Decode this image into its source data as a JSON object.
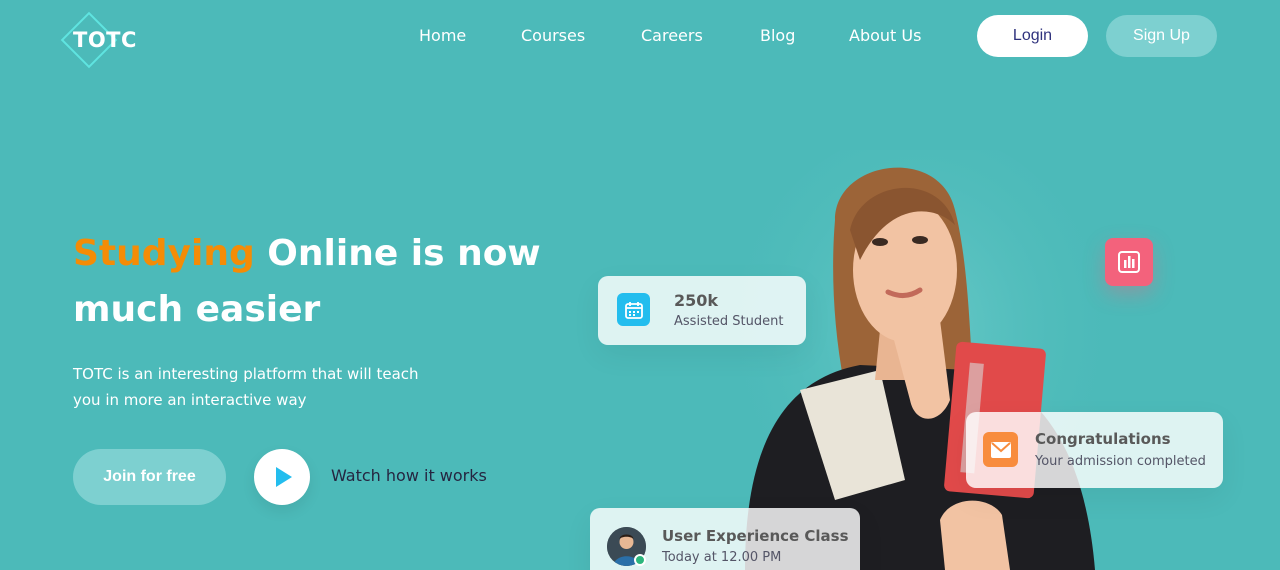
{
  "brand": {
    "logo_text": "TOTC"
  },
  "nav": {
    "links": [
      "Home",
      "Courses",
      "Careers",
      "Blog",
      "About Us"
    ],
    "login_label": "Login",
    "signup_label": "Sign Up"
  },
  "hero": {
    "title_accent": "Studying",
    "title_rest": " Online is now much easier",
    "description": "TOTC is an interesting platform that will teach you in more an interactive way",
    "join_label": "Join for free",
    "watch_label": "Watch how it works"
  },
  "cards": {
    "students": {
      "value": "250k",
      "label": "Assisted Student",
      "icon": "calendar-icon"
    },
    "congrats": {
      "title": "Congratulations",
      "subtitle": "Your admission completed",
      "icon": "mail-icon"
    },
    "class": {
      "title": "User Experience Class",
      "subtitle": "Today at 12.00 PM"
    },
    "chart_badge_icon": "bar-chart-icon"
  },
  "colors": {
    "background": "#4CBAB9",
    "accent": "#F48C06",
    "card_blue": "#23BDEE",
    "card_orange": "#F88C3D",
    "badge_pink": "#F3627C",
    "online_green": "#2CB67D"
  }
}
